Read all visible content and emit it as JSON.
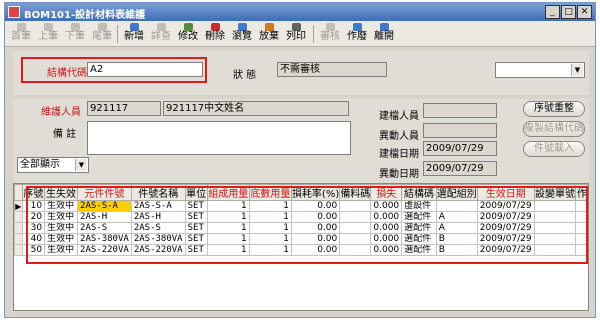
{
  "window": {
    "title": "BOM101-設計材料表維護"
  },
  "toolbar": {
    "buttons": [
      {
        "label": "首筆",
        "enabled": false
      },
      {
        "label": "上筆",
        "enabled": false
      },
      {
        "label": "下筆",
        "enabled": false
      },
      {
        "label": "尾筆",
        "enabled": false
      },
      {
        "label": "新增",
        "enabled": true
      },
      {
        "label": "詳查",
        "enabled": false
      },
      {
        "label": "修改",
        "enabled": true
      },
      {
        "label": "刪除",
        "enabled": true
      },
      {
        "label": "瀏覽",
        "enabled": true
      },
      {
        "label": "放棄",
        "enabled": true
      },
      {
        "label": "列印",
        "enabled": true
      },
      {
        "label": "審核",
        "enabled": false
      },
      {
        "label": "作廢",
        "enabled": true
      },
      {
        "label": "離開",
        "enabled": true
      }
    ]
  },
  "header": {
    "structure_code_label": "結構代碼",
    "structure_code_value": "A2",
    "status_label": "狀    態",
    "status_value": "不需審核",
    "right_combo_value": ""
  },
  "detail": {
    "maintainer_label": "維護人員",
    "maintainer_id": "921117",
    "maintainer_name": "921117中文姓名",
    "remark_label": "備    註",
    "remark_value": "",
    "filter_value": "全部顯示",
    "creator_label": "建檔人員",
    "creator_value": "",
    "modifier_label": "異動人員",
    "modifier_value": "",
    "created_date_label": "建檔日期",
    "created_date_value": "2009/07/29",
    "modified_date_label": "異動日期",
    "modified_date_value": "2009/07/29",
    "btn_reorder": "序號重整",
    "btn_copy": "複製結構代碼",
    "btn_import": "件號載入"
  },
  "grid": {
    "columns": [
      "序號",
      "生失效",
      "元件件號",
      "件號名稱",
      "單位",
      "組成用量",
      "底數用量",
      "損耗率(%)",
      "備料碼",
      "損失",
      "結構碼",
      "選配組別",
      "生效日期",
      "設變單號",
      "作"
    ],
    "rows": [
      [
        "10",
        "生效中",
        "2AS-S-A",
        "2AS-S-A",
        "SET",
        "1",
        "1",
        "0.00",
        "",
        "0.000",
        "虛設件",
        "",
        "2009/07/29",
        "",
        ""
      ],
      [
        "20",
        "生效中",
        "2AS-H",
        "2AS-H",
        "SET",
        "1",
        "1",
        "0.00",
        "",
        "0.000",
        "選配件",
        "A",
        "2009/07/29",
        "",
        ""
      ],
      [
        "30",
        "生效中",
        "2AS-S",
        "2AS-S",
        "SET",
        "1",
        "1",
        "0.00",
        "",
        "0.000",
        "選配件",
        "A",
        "2009/07/29",
        "",
        ""
      ],
      [
        "40",
        "生效中",
        "2AS-380VA",
        "2AS-380VA",
        "SET",
        "1",
        "1",
        "0.00",
        "",
        "0.000",
        "選配件",
        "B",
        "2009/07/29",
        "",
        ""
      ],
      [
        "50",
        "生效中",
        "2AS-220VA",
        "2AS-220VA",
        "SET",
        "1",
        "1",
        "0.00",
        "",
        "0.000",
        "選配件",
        "B",
        "2009/07/29",
        "",
        ""
      ]
    ]
  }
}
